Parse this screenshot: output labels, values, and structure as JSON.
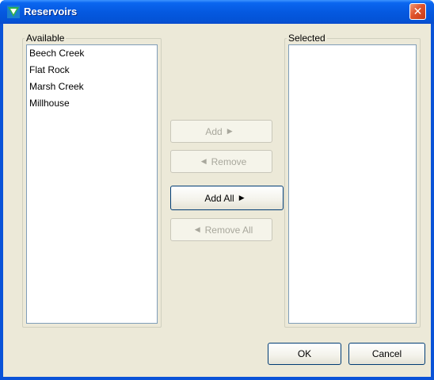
{
  "window": {
    "title": "Reservoirs"
  },
  "available": {
    "label": "Available",
    "items": [
      {
        "label": "Beech Creek"
      },
      {
        "label": "Flat Rock"
      },
      {
        "label": "Marsh Creek"
      },
      {
        "label": "Millhouse"
      }
    ]
  },
  "selected": {
    "label": "Selected",
    "items": []
  },
  "buttons": {
    "add": {
      "label": "Add",
      "enabled": false
    },
    "remove": {
      "label": "Remove",
      "enabled": false
    },
    "add_all": {
      "label": "Add All",
      "enabled": true
    },
    "remove_all": {
      "label": "Remove All",
      "enabled": false
    },
    "ok": {
      "label": "OK"
    },
    "cancel": {
      "label": "Cancel"
    }
  },
  "icons": {
    "app": "reservoir-app-icon",
    "close": "close-icon",
    "arrow_right": "arrow-right-icon",
    "arrow_left": "arrow-left-icon"
  },
  "colors": {
    "titlebar": "#0559e0",
    "window_bg": "#ece9d8",
    "close_button": "#e0532d",
    "disabled_text": "#a8a79c"
  }
}
